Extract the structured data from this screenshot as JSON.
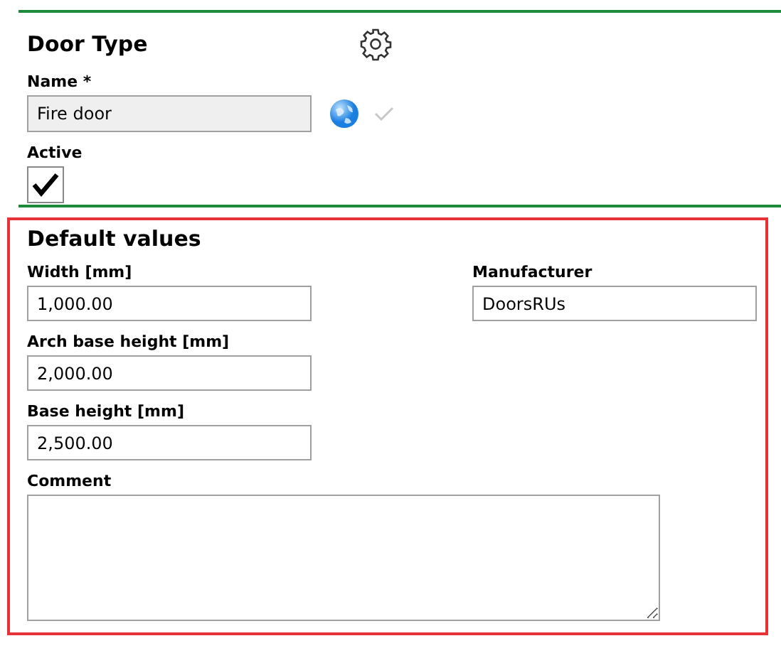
{
  "header": {
    "title": "Door Type"
  },
  "name_field": {
    "label": "Name *",
    "value": "Fire door"
  },
  "active": {
    "label": "Active",
    "checked": true
  },
  "defaults": {
    "title": "Default values",
    "left_fields": [
      {
        "label": "Width [mm]",
        "value": "1,000.00"
      },
      {
        "label": "Arch base height [mm]",
        "value": "2,000.00"
      },
      {
        "label": "Base height [mm]",
        "value": "2,500.00"
      }
    ],
    "right_fields": [
      {
        "label": "Manufacturer",
        "value": "DoorsRUs"
      }
    ],
    "comment": {
      "label": "Comment"
    }
  }
}
